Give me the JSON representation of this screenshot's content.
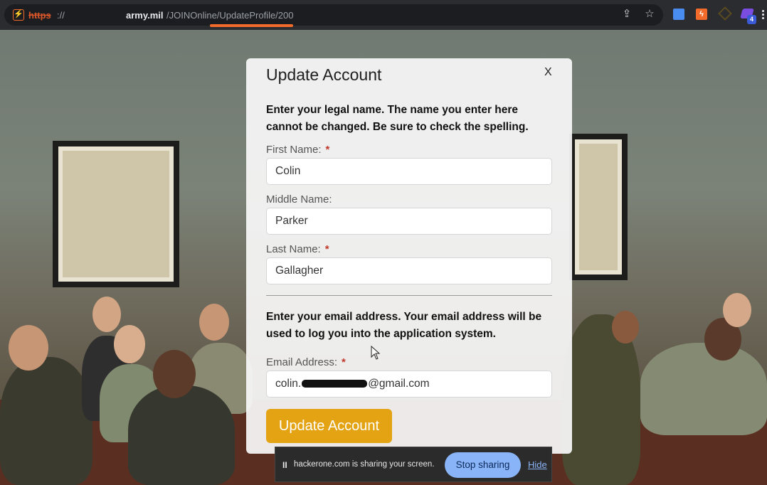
{
  "browser": {
    "url_scheme": "https",
    "url_separator": "://",
    "url_domain": "army.mil",
    "url_path": "/JOINOnline/UpdateProfile/200",
    "extension_badge": "4"
  },
  "modal": {
    "title": "Update Account",
    "close_label": "X",
    "name_instructions": "Enter your legal name. The name you enter here cannot be changed. Be sure to check the spelling.",
    "first_name": {
      "label": "First Name:",
      "required": "*",
      "value": "Colin"
    },
    "middle_name": {
      "label": "Middle Name:",
      "value": "Parker"
    },
    "last_name": {
      "label": "Last Name:",
      "required": "*",
      "value": "Gallagher"
    },
    "email_instructions": "Enter your email address. Your email address will be used to log you into the application system.",
    "email": {
      "label": "Email Address:",
      "required": "*",
      "value_prefix": "colin.",
      "value_suffix": "@gmail.com"
    },
    "submit_label": "Update Account"
  },
  "screen_share": {
    "pause_glyph": "II",
    "message": "hackerone.com is sharing your screen.",
    "stop_label": "Stop sharing",
    "hide_label": "Hide"
  },
  "colors": {
    "accent_button": "#e3a312",
    "share_button": "#8ab4f8",
    "url_underline": "#f26b2a"
  }
}
